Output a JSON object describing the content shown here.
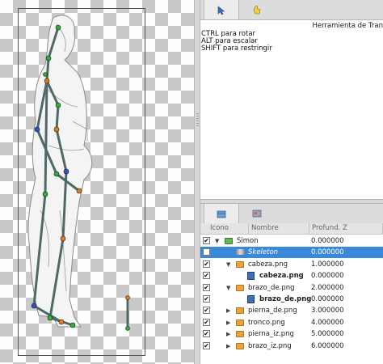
{
  "tool_panel": {
    "title": "Herramienta de Tran",
    "hints": [
      "CTRL para rotar",
      "ALT para escalar",
      "SHIFT para restringir"
    ],
    "tabs": [
      {
        "icon": "cursor-arrow-icon"
      },
      {
        "icon": "hand-pointer-icon"
      }
    ]
  },
  "layers_panel": {
    "tabs": [
      {
        "icon": "layers-stack-icon"
      },
      {
        "icon": "sprite-sheet-icon"
      }
    ],
    "columns": [
      "Icono",
      "Nombre",
      "Profund. Z"
    ],
    "rows": [
      {
        "checked": true,
        "expander": "open",
        "icon": "folder-green-icon",
        "name": "Simon",
        "depth": "0.000000",
        "style": "normal"
      },
      {
        "checked": false,
        "expander": "none",
        "icon": "bone-icon",
        "name": "Skeleton",
        "depth": "0.000000",
        "style": "italic",
        "selected": true
      },
      {
        "checked": true,
        "expander": "open",
        "icon": "folder-icon",
        "name": "cabeza.png",
        "depth": "1.000000",
        "style": "normal"
      },
      {
        "checked": true,
        "expander": "none",
        "icon": "image-icon",
        "name": "cabeza.png",
        "depth": "0.000000",
        "style": "bold"
      },
      {
        "checked": true,
        "expander": "open",
        "icon": "folder-icon",
        "name": "brazo_de.png",
        "depth": "2.000000",
        "style": "normal"
      },
      {
        "checked": true,
        "expander": "none",
        "icon": "image-icon",
        "name": "brazo_de.png",
        "depth": "0.000000",
        "style": "bold"
      },
      {
        "checked": true,
        "expander": "closed",
        "icon": "folder-icon",
        "name": "pierna_de.png",
        "depth": "3.000000",
        "style": "normal"
      },
      {
        "checked": true,
        "expander": "closed",
        "icon": "folder-icon",
        "name": "tronco.png",
        "depth": "4.000000",
        "style": "normal"
      },
      {
        "checked": true,
        "expander": "closed",
        "icon": "folder-icon",
        "name": "pierna_iz.png",
        "depth": "5.000000",
        "style": "normal"
      },
      {
        "checked": true,
        "expander": "closed",
        "icon": "folder-icon",
        "name": "brazo_iz.png",
        "depth": "6.000000",
        "style": "normal"
      }
    ]
  },
  "colors": {
    "selection": "#3a88d8",
    "bone": "#506868",
    "joint_green": "#2fae2f",
    "joint_orange": "#e07a1c",
    "joint_blue": "#2f52c8"
  }
}
